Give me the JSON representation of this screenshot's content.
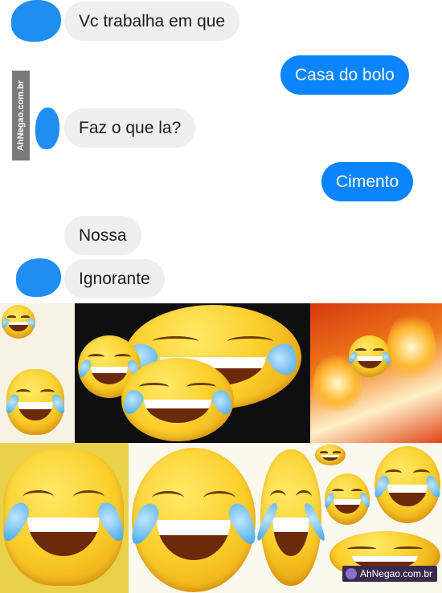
{
  "chat": {
    "messages": [
      {
        "sender": "them",
        "text": "Vc trabalha em que"
      },
      {
        "sender": "me",
        "text": "Casa do bolo"
      },
      {
        "sender": "them",
        "text": "Faz o que la?"
      },
      {
        "sender": "me",
        "text": "Cimento"
      },
      {
        "sender": "them",
        "text": "Nossa"
      },
      {
        "sender": "them",
        "text": "Ignorante"
      }
    ]
  },
  "watermarks": {
    "side": "AhNegao.com.br",
    "corner": "AhNegao.com.br"
  },
  "colors": {
    "sent_bubble": "#0a84ff",
    "received_bubble": "#efefef",
    "avatar_scribble": "#1f8ef1"
  },
  "collage": {
    "subject": "crying-laughing-emoji"
  }
}
